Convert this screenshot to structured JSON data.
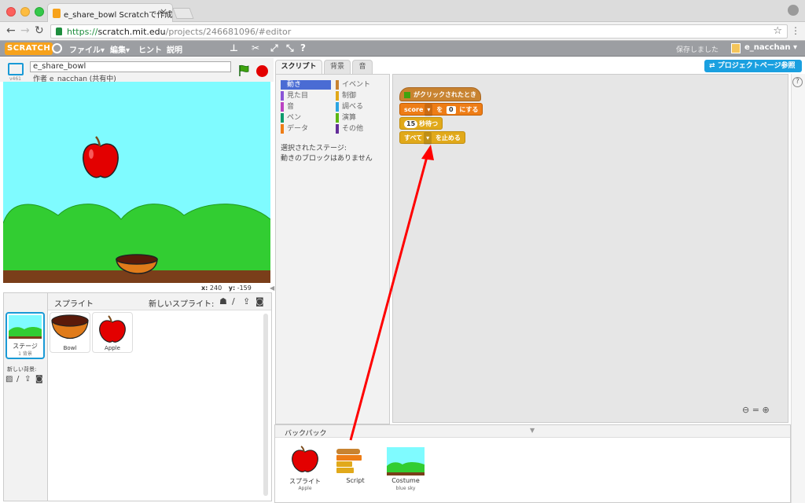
{
  "browser": {
    "tab_title": "e_share_bowl Scratchで作成",
    "url_scheme": "https://",
    "url_host": "scratch.mit.edu",
    "url_path": "/projects/246681096/#editor"
  },
  "menubar": {
    "logo": "SCRATCH",
    "file": "ファイル▾",
    "edit": "編集▾",
    "tips": "ヒント",
    "about": "説明",
    "saved": "保存しました",
    "username": "e_nacchan ▾"
  },
  "project": {
    "title": "e_share_bowl",
    "author": "作者 e_nacchan (共有中)",
    "version": "v461",
    "project_page_button": "プロジェクトページ参照"
  },
  "stage_coords": {
    "x_label": "x:",
    "x_value": "240",
    "y_label": "y:",
    "y_value": "-159"
  },
  "sprites_pane": {
    "title": "スプライト",
    "new_sprite": "新しいスプライト:",
    "stage_label": "ステージ",
    "stage_sub": "1 背景",
    "new_backdrop": "新しい背景:",
    "sprites": [
      {
        "name": "Bowl"
      },
      {
        "name": "Apple"
      }
    ]
  },
  "tabs": {
    "scripts": "スクリプト",
    "backdrops": "背景",
    "sounds": "音"
  },
  "categories": [
    {
      "label": "動き",
      "color": "#4a6cd4"
    },
    {
      "label": "イベント",
      "color": "#c88330"
    },
    {
      "label": "見た目",
      "color": "#8a55d7"
    },
    {
      "label": "制御",
      "color": "#e1a91a"
    },
    {
      "label": "音",
      "color": "#bb42c3"
    },
    {
      "label": "調べる",
      "color": "#2ca5e2"
    },
    {
      "label": "ペン",
      "color": "#0e9a6c"
    },
    {
      "label": "演算",
      "color": "#5cb712"
    },
    {
      "label": "データ",
      "color": "#ee7d16"
    },
    {
      "label": "その他",
      "color": "#632d99"
    }
  ],
  "palette_message": {
    "line1": "選択されたステージ:",
    "line2": "動きのブロックはありません"
  },
  "script": {
    "hat": "がクリックされたとき",
    "set_var": "score",
    "set_to": "を",
    "set_value": "0",
    "set_end": "にする",
    "wait_value": "15",
    "wait_label": "秒待つ",
    "stop_option": "すべて",
    "stop_label": "を止める"
  },
  "backpack": {
    "title": "バックパック",
    "items": [
      {
        "label": "スプライト",
        "sub": "Apple"
      },
      {
        "label": "Script",
        "sub": ""
      },
      {
        "label": "Costume",
        "sub": "blue sky"
      }
    ]
  },
  "colors": {
    "sky": "#7ffbff",
    "grass": "#32cd32",
    "ground": "#7a3e1a",
    "apple": "#e30000",
    "bowl": "#e07b1a",
    "arrow": "#ff0000"
  }
}
